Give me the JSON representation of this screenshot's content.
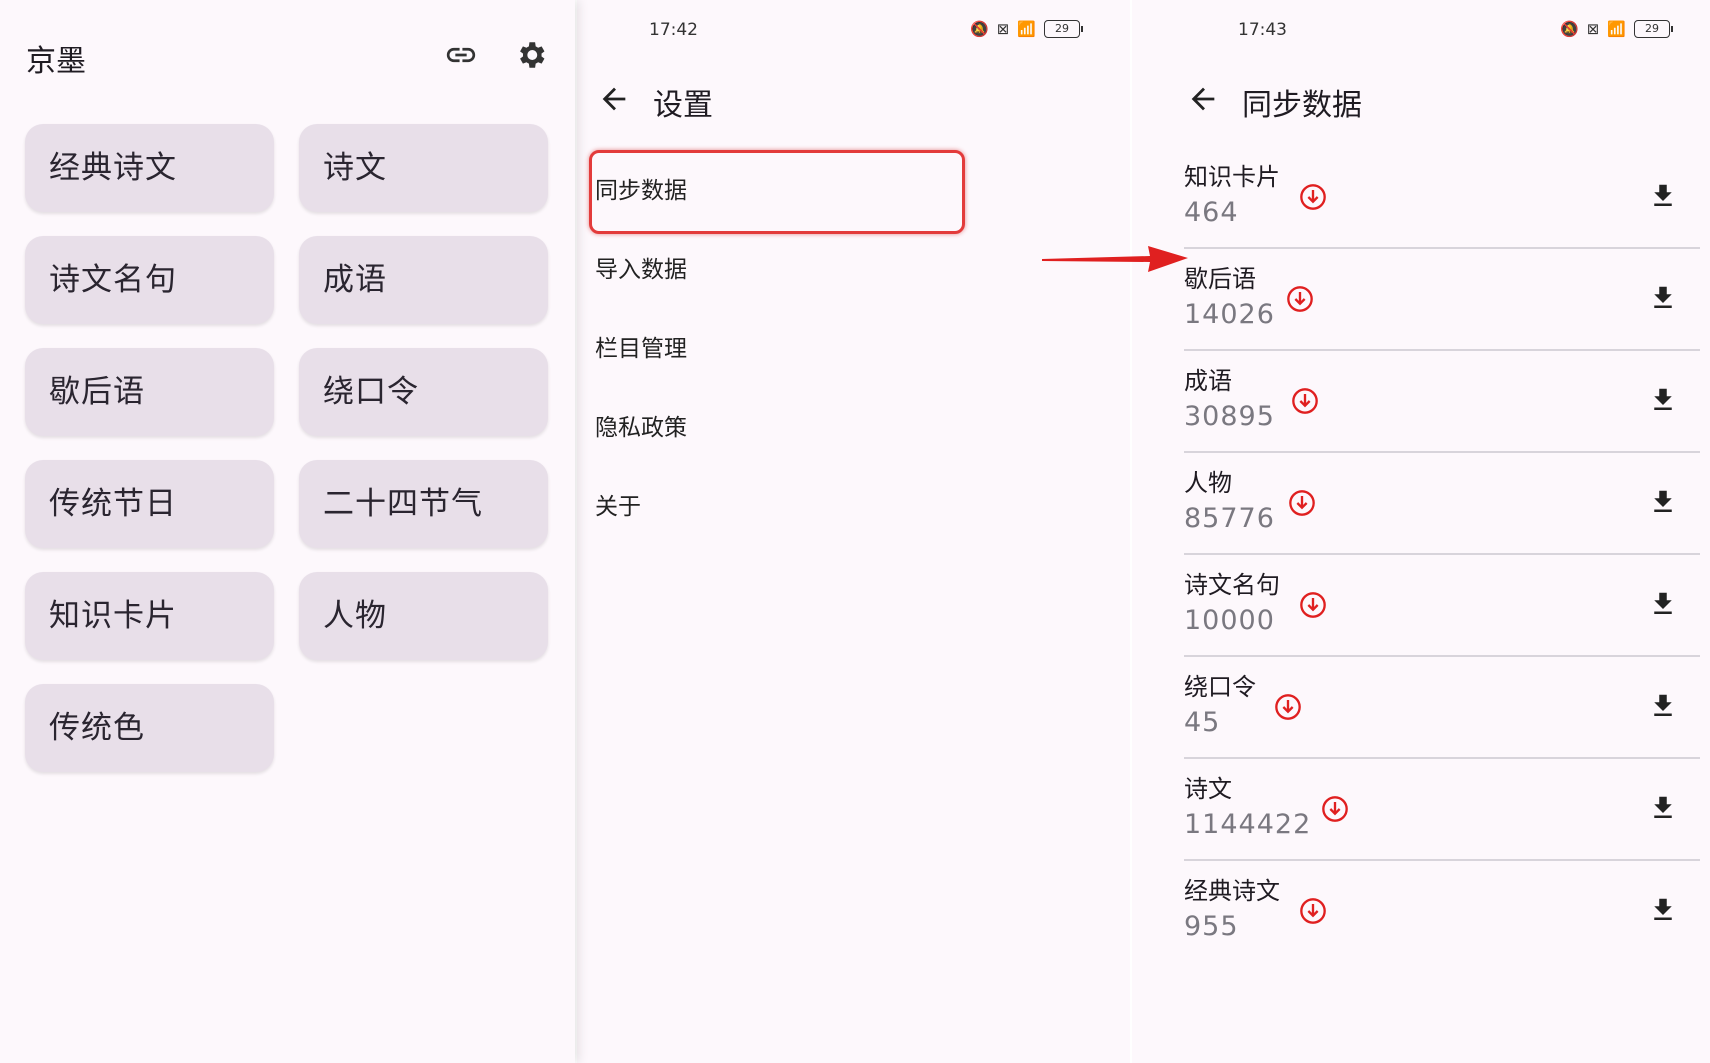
{
  "home": {
    "title": "京墨",
    "tiles": [
      "经典诗文",
      "诗文",
      "诗文名句",
      "成语",
      "歇后语",
      "绕口令",
      "传统节日",
      "二十四节气",
      "知识卡片",
      "人物",
      "传统色"
    ]
  },
  "settings": {
    "status_time": "17:42",
    "battery": "29",
    "title": "设置",
    "items": [
      "同步数据",
      "导入数据",
      "栏目管理",
      "隐私政策",
      "关于"
    ]
  },
  "sync": {
    "status_time": "17:43",
    "battery": "29",
    "title": "同步数据",
    "rows": [
      {
        "name": "知识卡片",
        "count": "464"
      },
      {
        "name": "歇后语",
        "count": "14026"
      },
      {
        "name": "成语",
        "count": "30895"
      },
      {
        "name": "人物",
        "count": "85776"
      },
      {
        "name": "诗文名句",
        "count": "10000"
      },
      {
        "name": "绕口令",
        "count": "45"
      },
      {
        "name": "诗文",
        "count": "1144422"
      },
      {
        "name": "经典诗文",
        "count": "955"
      }
    ]
  },
  "colors": {
    "tile_bg": "#e8dfe9",
    "page_bg": "#fdf8fc",
    "annotation_red": "#e33b3b"
  }
}
